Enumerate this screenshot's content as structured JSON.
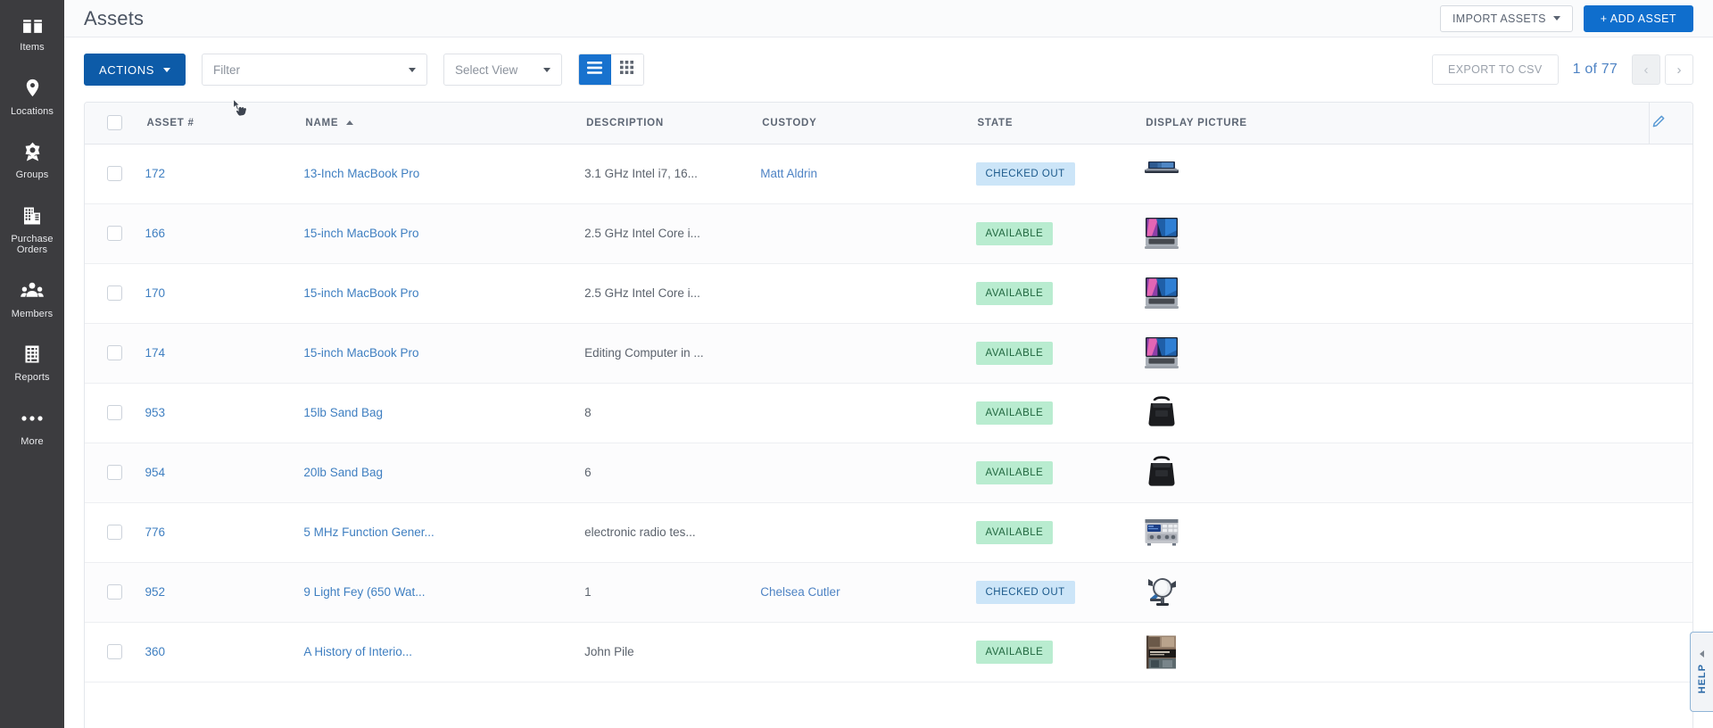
{
  "sidebar": {
    "items": [
      {
        "label": "Items",
        "icon": "box-icon"
      },
      {
        "label": "Locations",
        "icon": "map-pin-icon"
      },
      {
        "label": "Groups",
        "icon": "group-star-icon"
      },
      {
        "label": "Purchase\nOrders",
        "icon": "purchase-orders-icon"
      },
      {
        "label": "Members",
        "icon": "members-icon"
      },
      {
        "label": "Reports",
        "icon": "reports-icon"
      },
      {
        "label": "More",
        "icon": "ellipsis-icon"
      }
    ]
  },
  "header": {
    "title": "Assets",
    "import_label": "IMPORT ASSETS",
    "add_label": "+ ADD ASSET"
  },
  "toolbar": {
    "actions_label": "ACTIONS",
    "filter_placeholder": "Filter",
    "view_placeholder": "Select View",
    "list_view_icon": "list-view-icon",
    "grid_view_icon": "grid-view-icon",
    "active_view": "list",
    "export_label": "EXPORT TO CSV",
    "page_count": "1 of 77",
    "prev_label": "‹",
    "next_label": "›"
  },
  "table": {
    "columns": [
      {
        "key": "asset",
        "label": "ASSET #",
        "sorted": false
      },
      {
        "key": "name",
        "label": "NAME",
        "sorted": true
      },
      {
        "key": "desc",
        "label": "DESCRIPTION",
        "sorted": false
      },
      {
        "key": "custody",
        "label": "CUSTODY",
        "sorted": false
      },
      {
        "key": "state",
        "label": "STATE",
        "sorted": false
      },
      {
        "key": "picture",
        "label": "DISPLAY PICTURE",
        "sorted": false
      }
    ],
    "edit_icon": "pencil-icon",
    "rows": [
      {
        "asset": "172",
        "name": "13-Inch MacBook Pro",
        "desc": "3.1 GHz Intel i7, 16...",
        "custody": "Matt Aldrin",
        "state": "CHECKED OUT",
        "picture": "macbook-side-thumb"
      },
      {
        "asset": "166",
        "name": "15-inch MacBook Pro",
        "desc": "2.5 GHz Intel Core i...",
        "custody": "",
        "state": "AVAILABLE",
        "picture": "macbook-open-thumb"
      },
      {
        "asset": "170",
        "name": "15-inch MacBook Pro",
        "desc": "2.5 GHz Intel Core i...",
        "custody": "",
        "state": "AVAILABLE",
        "picture": "macbook-open-thumb"
      },
      {
        "asset": "174",
        "name": "15-inch MacBook Pro",
        "desc": "Editing Computer in ...",
        "custody": "",
        "state": "AVAILABLE",
        "picture": "macbook-open-thumb"
      },
      {
        "asset": "953",
        "name": "15lb Sand Bag",
        "desc": "8",
        "custody": "",
        "state": "AVAILABLE",
        "picture": "sandbag-thumb"
      },
      {
        "asset": "954",
        "name": "20lb Sand Bag",
        "desc": "6",
        "custody": "",
        "state": "AVAILABLE",
        "picture": "sandbag-thumb"
      },
      {
        "asset": "776",
        "name": "5 MHz Function Gener...",
        "desc": "electronic radio tes...",
        "custody": "",
        "state": "AVAILABLE",
        "picture": "function-generator-thumb"
      },
      {
        "asset": "952",
        "name": "9 Light Fey (650 Wat...",
        "desc": "1",
        "custody": "Chelsea Cutler",
        "state": "CHECKED OUT",
        "picture": "fresnel-light-thumb"
      },
      {
        "asset": "360",
        "name": "A History of Interio...",
        "desc": "John Pile",
        "custody": "",
        "state": "AVAILABLE",
        "picture": "book-cover-thumb"
      }
    ]
  },
  "help": {
    "label": "HELP"
  },
  "colors": {
    "sidebar_bg": "#3c3c3f",
    "primary": "#0f6ecd",
    "actions_blue": "#0d5ba8",
    "link": "#3f7fc1",
    "available_bg": "#b9ecd0",
    "available_text": "#20673f",
    "checkedout_bg": "#cce5f8",
    "checkedout_text": "#1c5a8c"
  }
}
